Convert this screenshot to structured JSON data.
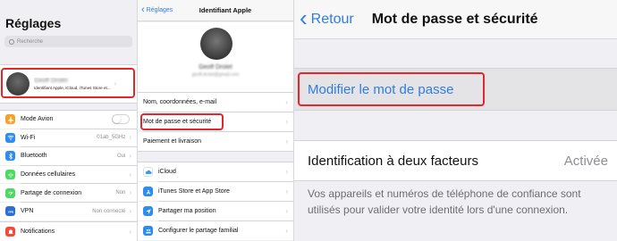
{
  "settings": {
    "title": "Réglages",
    "search_placeholder": "Recherche",
    "profile": {
      "name": "Geoff Drolet",
      "subtitle": "Identifiant Apple, iCloud, iTunes Store et..."
    },
    "items": [
      {
        "label": "Mode Avion",
        "icon": "airplane-icon",
        "color": "#f7a028",
        "value": "",
        "toggle": true
      },
      {
        "label": "Wi-Fi",
        "icon": "wifi-icon",
        "color": "#2d8cf0",
        "value": "01ab_5GHz"
      },
      {
        "label": "Bluetooth",
        "icon": "bluetooth-icon",
        "color": "#2d8cf0",
        "value": "Oui"
      },
      {
        "label": "Données cellulaires",
        "icon": "antenna-icon",
        "color": "#4cd964",
        "value": ""
      },
      {
        "label": "Partage de connexion",
        "icon": "link-icon",
        "color": "#4cd964",
        "value": "Non"
      },
      {
        "label": "VPN",
        "icon": "vpn-icon",
        "color": "#2d6fd6",
        "value": "Non connecté"
      }
    ],
    "notifications": {
      "label": "Notifications",
      "icon": "bell-icon",
      "color": "#f04a3a"
    }
  },
  "apple_id": {
    "back": "Réglages",
    "title": "Identifiant Apple",
    "profile_name": "Geoff Drolet",
    "profile_email": "geoff.drolet@gmail.com",
    "menu": [
      {
        "label": "Nom, coordonnées, e-mail"
      },
      {
        "label": "Mot de passe et sécurité"
      },
      {
        "label": "Paiement et livraison"
      }
    ],
    "services": [
      {
        "label": "iCloud",
        "icon": "cloud-icon",
        "color": "#ffffff"
      },
      {
        "label": "iTunes Store et App Store",
        "icon": "appstore-icon",
        "color": "#2d8cf0"
      },
      {
        "label": "Partager ma position",
        "icon": "location-icon",
        "color": "#2d8cf0"
      },
      {
        "label": "Configurer le partage familial",
        "icon": "family-icon",
        "color": "#2d8cf0"
      }
    ]
  },
  "security": {
    "back": "Retour",
    "title": "Mot de passe et sécurité",
    "change_password": "Modifier le mot de passe",
    "two_factor_label": "Identification à deux facteurs",
    "two_factor_value": "Activée",
    "description": "Vos appareils et numéros de téléphone de confiance sont utilisés pour valider votre identité lors d'une connexion."
  },
  "colors": {
    "accent": "#2f7de0",
    "highlight": "#e3262b"
  }
}
